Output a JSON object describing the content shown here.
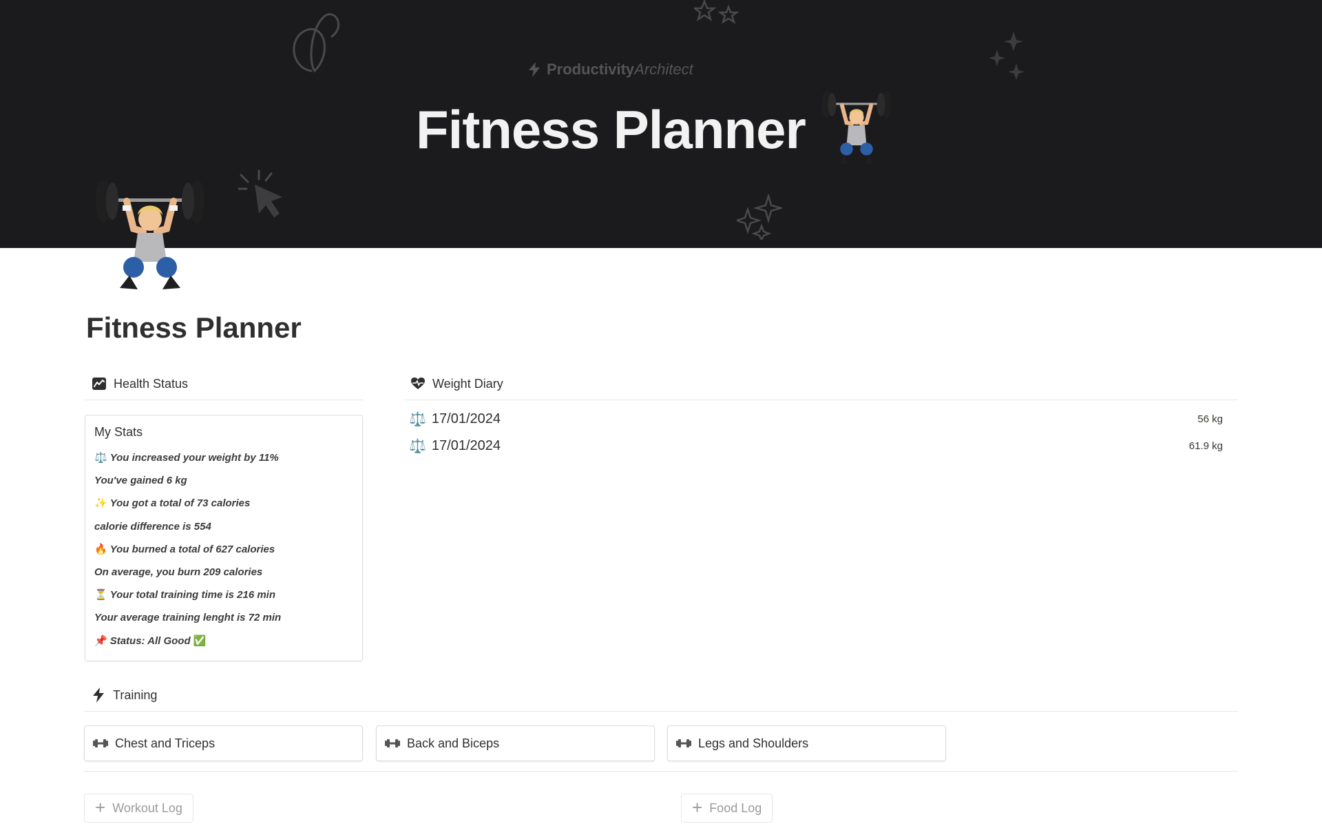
{
  "cover": {
    "brand_primary": "Productivity",
    "brand_secondary": "Architect",
    "title": "Fitness Planner",
    "title_emoji": "weightlifter-icon"
  },
  "page": {
    "icon": "weightlifter-icon",
    "title": "Fitness Planner"
  },
  "health_status": {
    "header": "Health Status",
    "card_title": "My Stats",
    "lines": [
      {
        "emoji": "⚖️",
        "text": "You increased your weight by 11%"
      },
      {
        "emoji": "",
        "text": "You've gained 6 kg"
      },
      {
        "emoji": "✨",
        "text": "You got a total of 73 calories"
      },
      {
        "emoji": "",
        "text": "calorie difference is 554"
      },
      {
        "emoji": "🔥",
        "text": "You burned a total of 627 calories"
      },
      {
        "emoji": "",
        "text": "On average, you burn 209 calories"
      },
      {
        "emoji": "⏳",
        "text": "Your total training time is 216 min"
      },
      {
        "emoji": "",
        "text": "Your average training lenght is 72 min"
      },
      {
        "emoji": "📌",
        "text": "Status: All Good",
        "suffix": "✅"
      }
    ]
  },
  "weight_diary": {
    "header": "Weight Diary",
    "entries": [
      {
        "icon": "⚖️",
        "date": "17/01/2024",
        "weight": "56 kg"
      },
      {
        "icon": "⚖️",
        "date": "17/01/2024",
        "weight": "61.9 kg"
      }
    ]
  },
  "training": {
    "header": "Training",
    "buttons": [
      {
        "icon": "dumbbell-icon",
        "label": "Chest and Triceps"
      },
      {
        "icon": "dumbbell-icon",
        "label": "Back and Biceps"
      },
      {
        "icon": "dumbbell-icon",
        "label": "Legs and Shoulders"
      }
    ]
  },
  "bottom_buttons": {
    "workout_log": "Workout Log",
    "food_log": "Food Log"
  },
  "colors": {
    "cover_bg": "#1b1b1d",
    "text": "#37352f",
    "muted": "#9b9a97",
    "border": "#dcdcda"
  }
}
